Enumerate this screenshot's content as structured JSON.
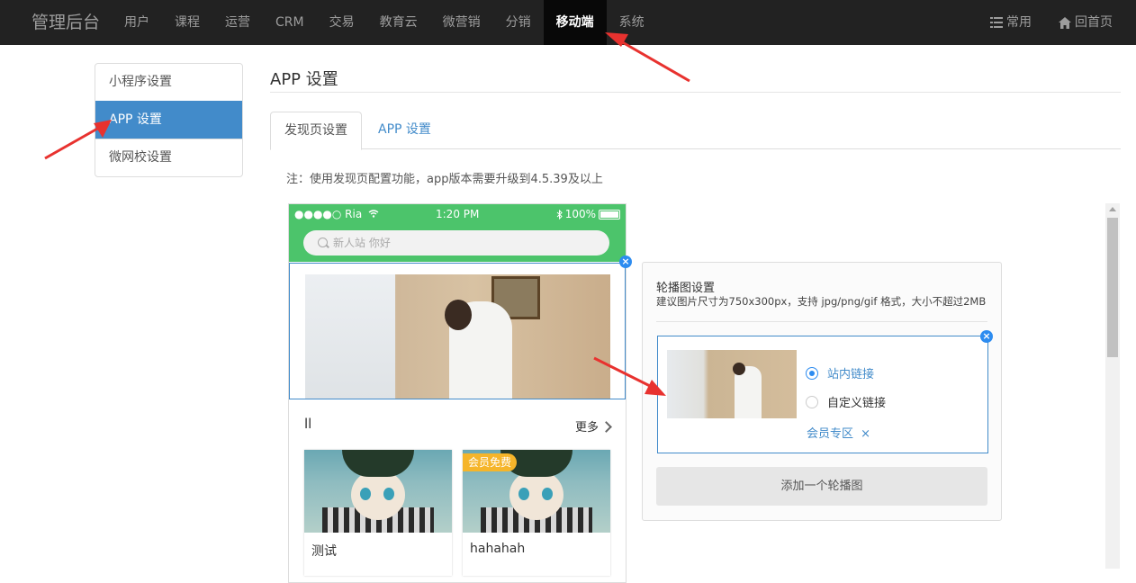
{
  "topnav": {
    "brand": "管理后台",
    "items": [
      "用户",
      "课程",
      "运营",
      "CRM",
      "交易",
      "教育云",
      "微营销",
      "分销",
      "移动端",
      "系统"
    ],
    "active_index": 8,
    "right": {
      "common": "常用",
      "home": "回首页"
    }
  },
  "sidebar": {
    "items": [
      "小程序设置",
      "APP 设置",
      "微网校设置"
    ],
    "active_index": 1
  },
  "page": {
    "title": "APP 设置",
    "tabs": [
      "发现页设置",
      "APP 设置"
    ],
    "active_tab": 0,
    "note": "注：使用发现页配置功能，app版本需要升级到4.5.39及以上"
  },
  "phone": {
    "status": {
      "carrier": "●●●●○ Ria",
      "time": "1:20 PM",
      "battery": "100%"
    },
    "search_placeholder": "新人站 你好",
    "section_title": "ll",
    "more": "更多",
    "cards": [
      {
        "title": "测试",
        "badge": ""
      },
      {
        "title": "hahahah",
        "badge": "会员免费"
      }
    ],
    "close_glyph": "×"
  },
  "panel": {
    "title": "轮播图设置",
    "desc": "建议图片尺寸为750x300px，支持 jpg/png/gif 格式，大小不超过2MB",
    "options": [
      "站内链接",
      "自定义链接"
    ],
    "selected_option": 0,
    "link_tag": "会员专区",
    "link_remove": "×",
    "add_button": "添加一个轮播图",
    "close_glyph": "×"
  },
  "colors": {
    "topbar": "#222222",
    "accent": "#428bca",
    "phone_green": "#4cc46b",
    "badge_blue": "#2d8cf0",
    "vip_yellow": "#f5b52a",
    "annotation_red": "#e8322f"
  }
}
